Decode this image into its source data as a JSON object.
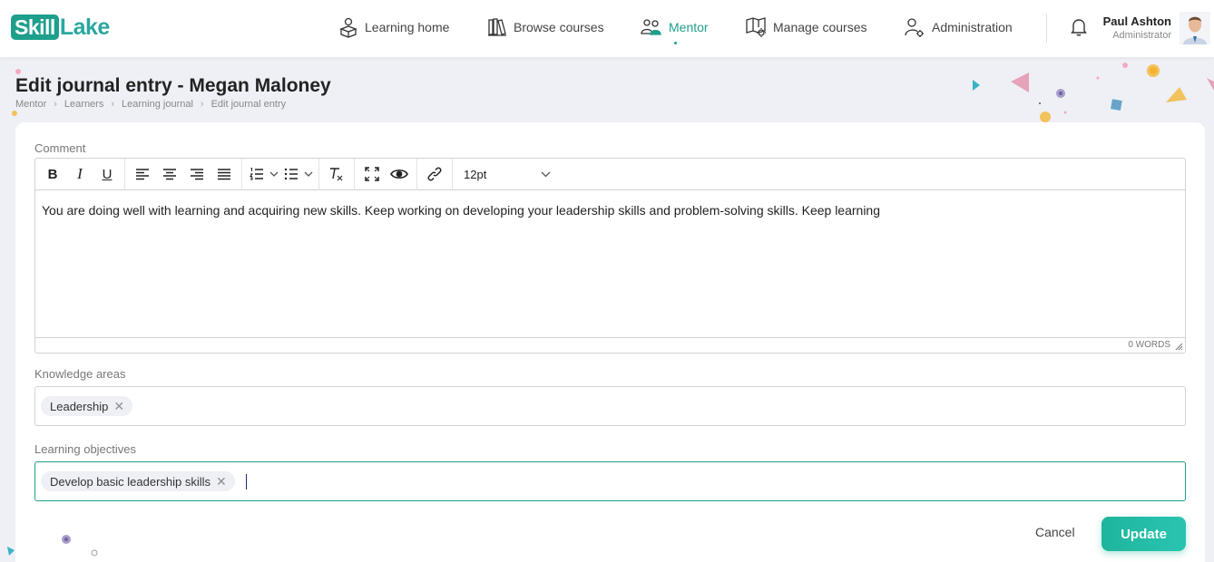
{
  "brand": {
    "part1": "Skill",
    "part2": "Lake"
  },
  "nav": [
    {
      "label": "Learning home",
      "icon": "learning-home-icon"
    },
    {
      "label": "Browse courses",
      "icon": "books-icon"
    },
    {
      "label": "Mentor",
      "icon": "mentor-icon",
      "active": true
    },
    {
      "label": "Manage courses",
      "icon": "manage-courses-icon"
    },
    {
      "label": "Administration",
      "icon": "admin-user-gear-icon"
    }
  ],
  "user": {
    "name": "Paul Ashton",
    "role": "Administrator"
  },
  "page": {
    "title": "Edit journal entry - Megan Maloney"
  },
  "breadcrumb": [
    "Mentor",
    "Learners",
    "Learning journal",
    "Edit journal entry"
  ],
  "form": {
    "comment_label": "Comment",
    "font_size": "12pt",
    "comment_text": "You are doing well with learning and acquiring new skills. Keep working on developing your leadership skills and problem-solving skills. Keep learning",
    "word_count": "0 WORDS",
    "knowledge_label": "Knowledge areas",
    "knowledge_chip": "Leadership",
    "objectives_label": "Learning objectives",
    "objective_chip": "Develop basic leadership skills",
    "chip_remove": "✕",
    "cancel_label": "Cancel",
    "update_label": "Update"
  },
  "colors": {
    "accent": "#1e9f8c",
    "button": "#1fb59c",
    "background": "#eef0f6"
  }
}
